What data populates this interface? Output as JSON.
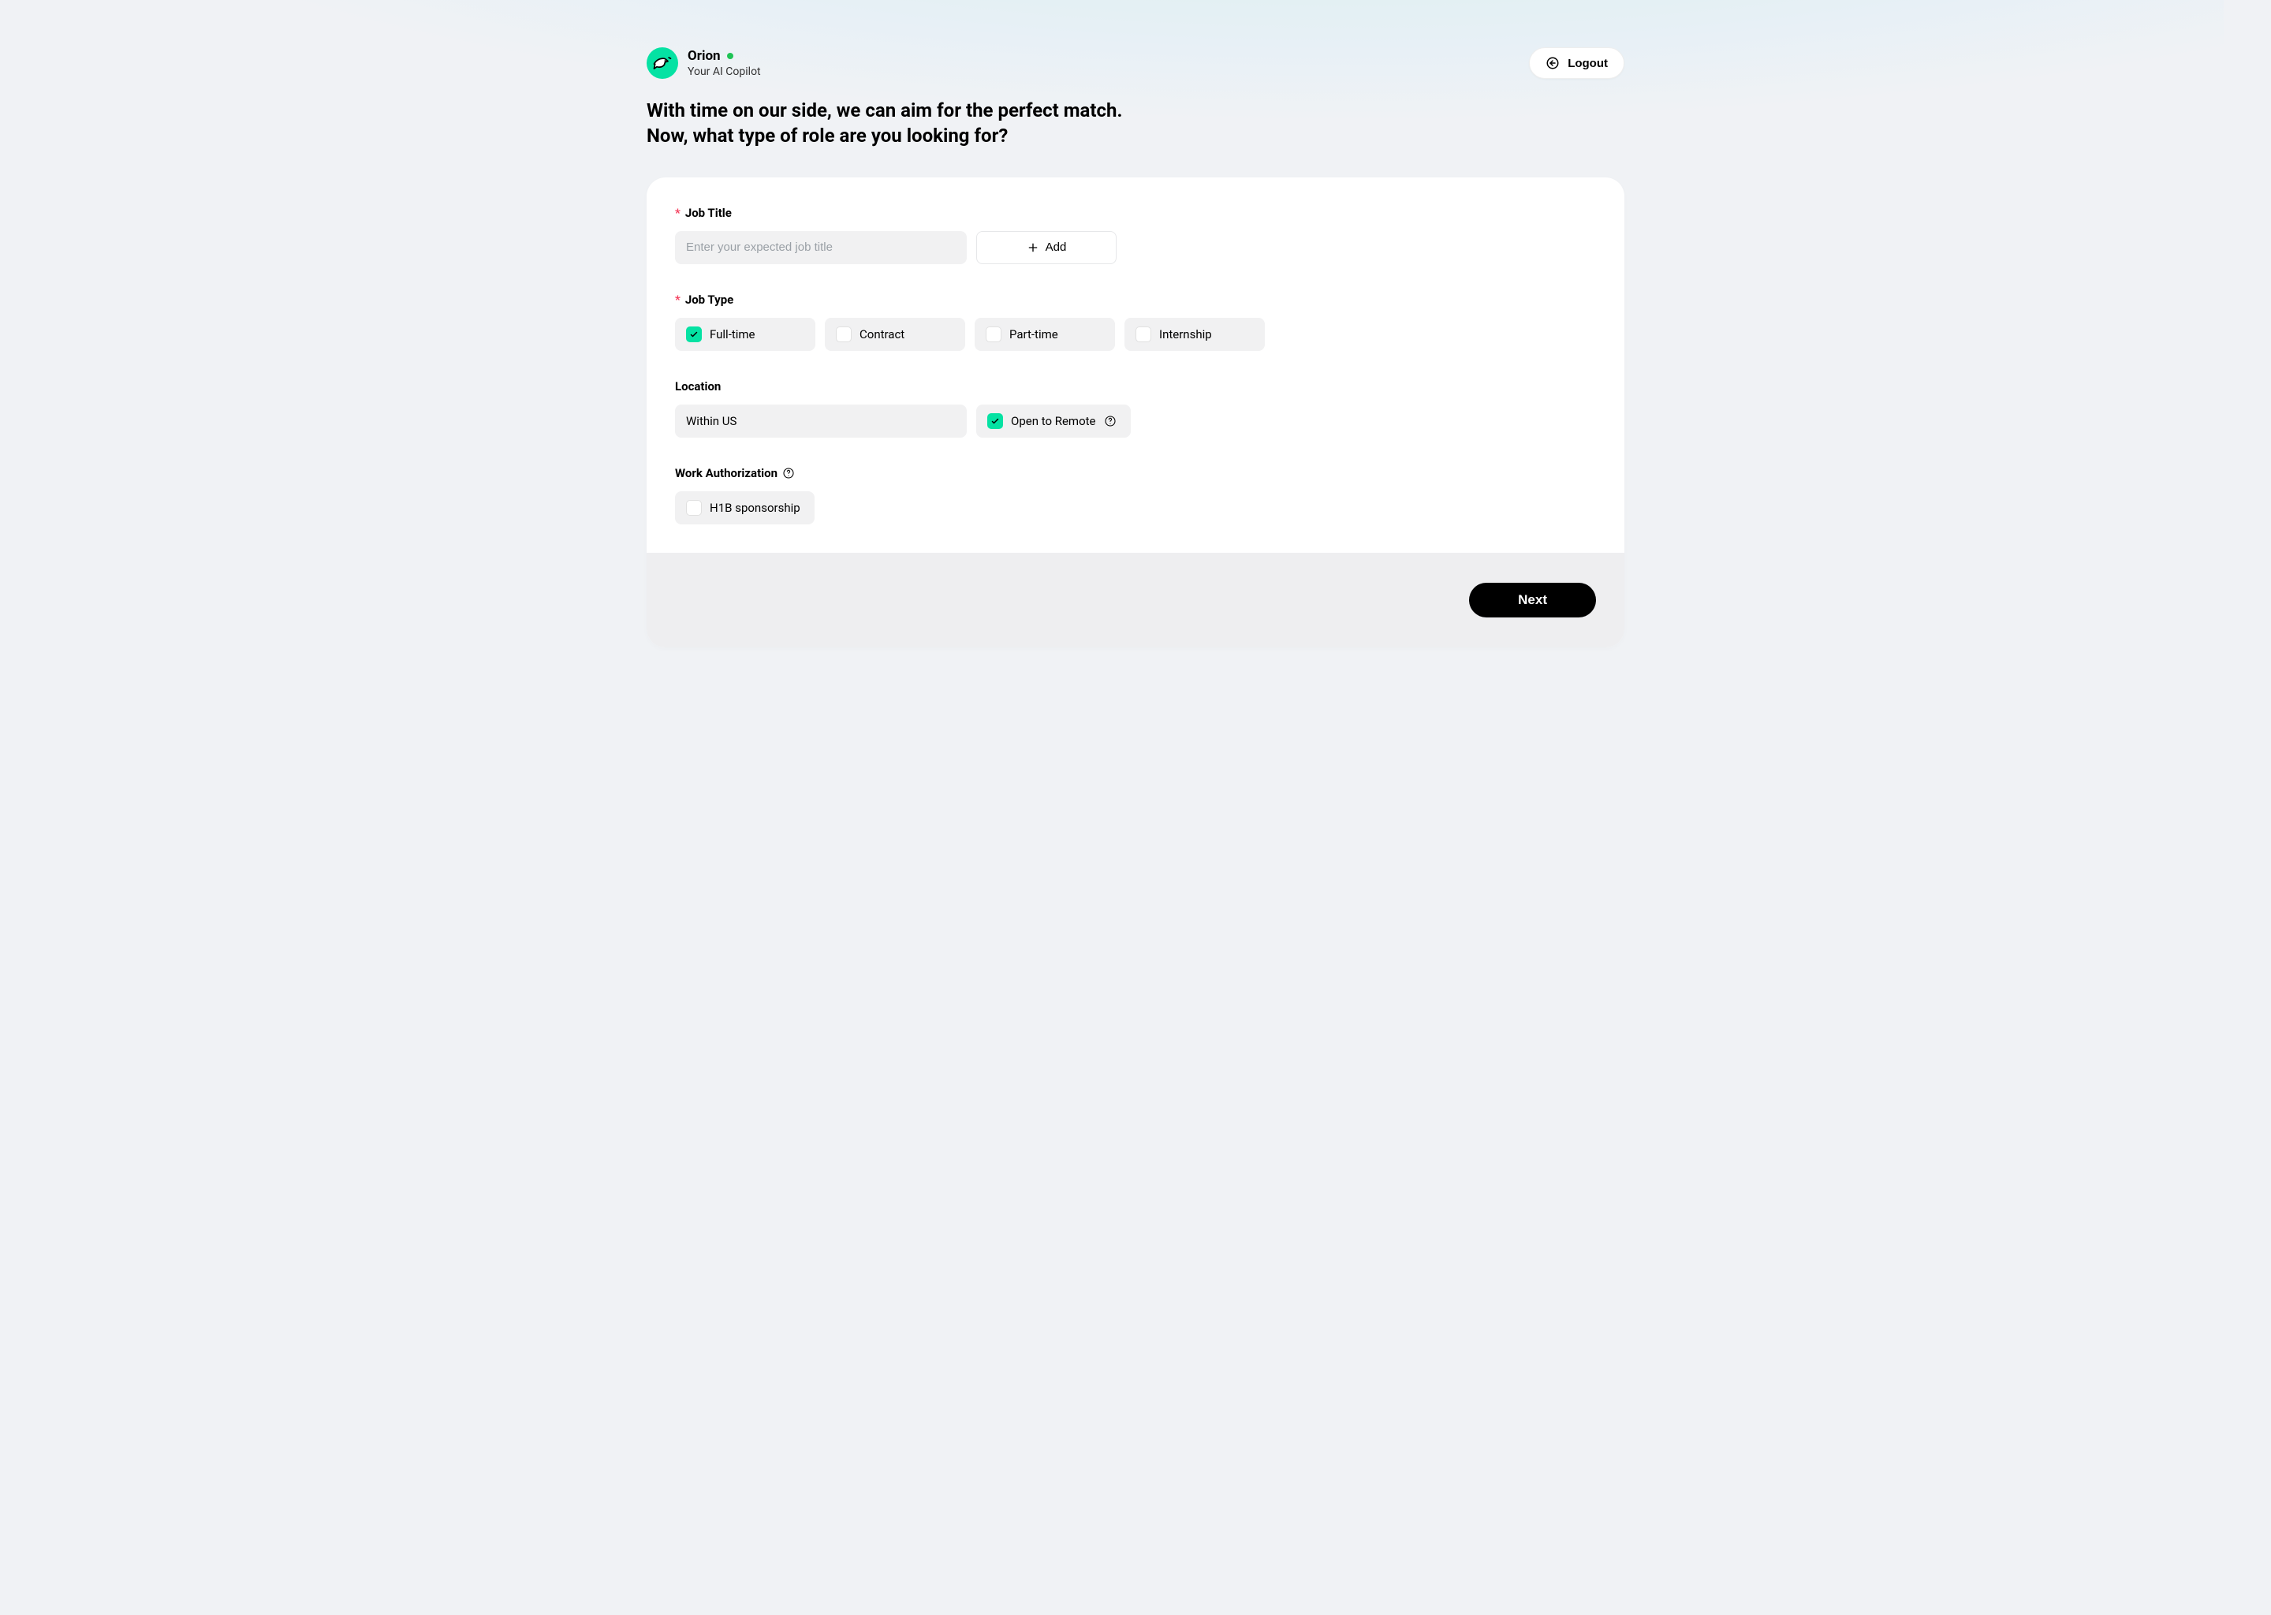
{
  "brand": {
    "name": "Orion",
    "subtitle": "Your AI Copilot"
  },
  "header": {
    "logout_label": "Logout"
  },
  "page_title": "With time on our side, we can aim for the perfect match.\nNow, what type of role are you looking for?",
  "form": {
    "job_title": {
      "label": "Job Title",
      "required": true,
      "placeholder": "Enter your expected job title",
      "value": "",
      "add_label": "Add"
    },
    "job_type": {
      "label": "Job Type",
      "required": true,
      "options": [
        {
          "label": "Full-time",
          "checked": true
        },
        {
          "label": "Contract",
          "checked": false
        },
        {
          "label": "Part-time",
          "checked": false
        },
        {
          "label": "Internship",
          "checked": false
        }
      ]
    },
    "location": {
      "label": "Location",
      "value": "Within US",
      "remote_label": "Open to Remote",
      "remote_checked": true
    },
    "work_auth": {
      "label": "Work Authorization",
      "option_label": "H1B sponsorship",
      "option_checked": false
    }
  },
  "footer": {
    "next_label": "Next"
  },
  "colors": {
    "accent": "#05e2a3",
    "bg": "#f0f2f5"
  }
}
